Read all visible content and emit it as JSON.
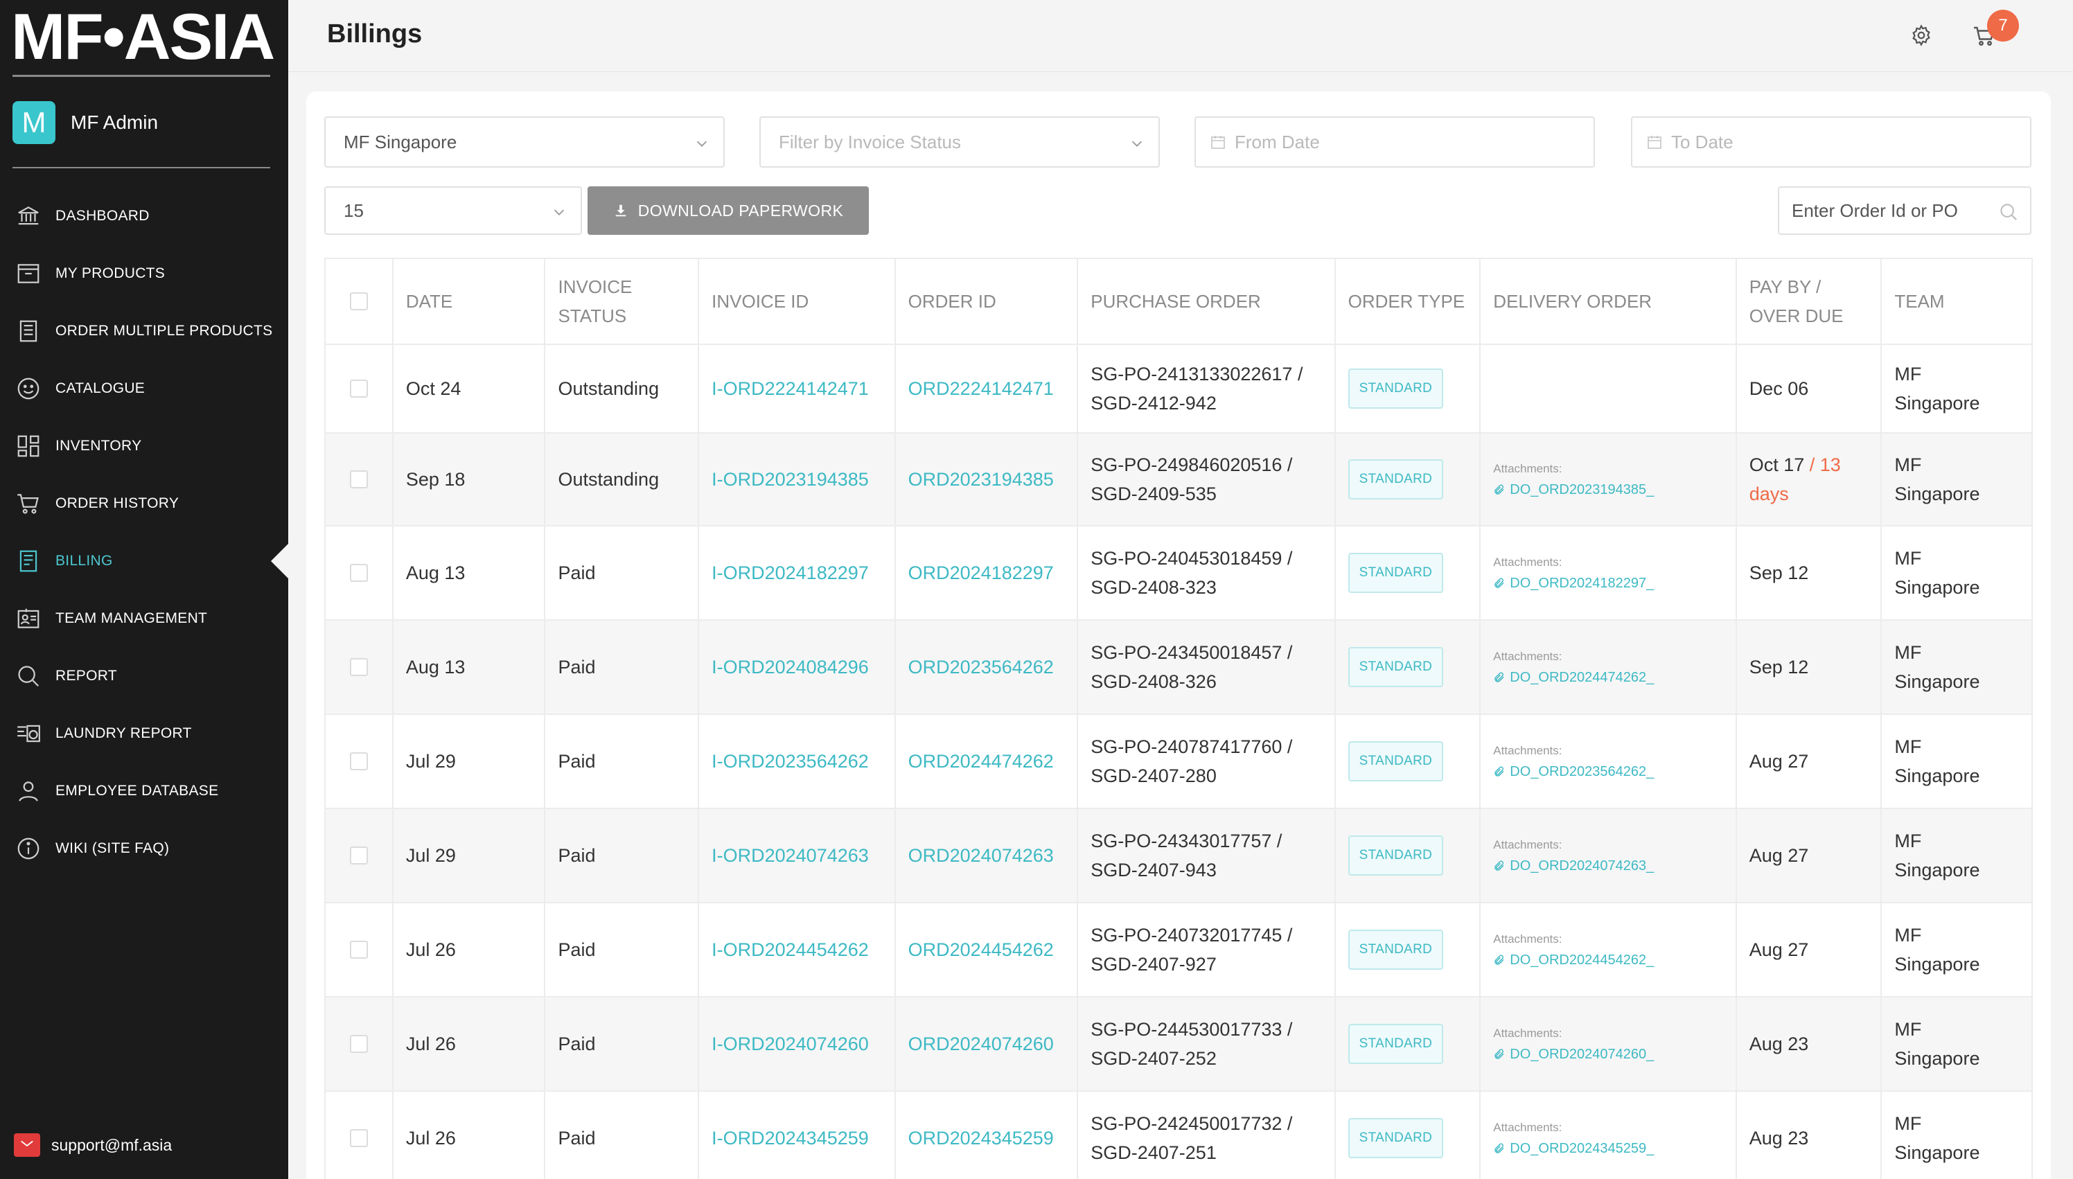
{
  "app": {
    "logo_text": "MF•ASIA",
    "admin_initial": "M",
    "admin_name": "MF Admin",
    "support_email": "support@mf.asia",
    "accent_color": "#3db9c4",
    "badge_color": "#ef6a47"
  },
  "nav": [
    {
      "label": "DASHBOARD",
      "icon": "bank-icon",
      "active": false
    },
    {
      "label": "MY PRODUCTS",
      "icon": "product-box-icon",
      "active": false
    },
    {
      "label": "ORDER MULTIPLE PRODUCTS",
      "icon": "list-document-icon",
      "active": false
    },
    {
      "label": "CATALOGUE",
      "icon": "smiley-icon",
      "active": false
    },
    {
      "label": "INVENTORY",
      "icon": "grid-icon",
      "active": false
    },
    {
      "label": "ORDER HISTORY",
      "icon": "cart-icon",
      "active": false
    },
    {
      "label": "BILLING",
      "icon": "invoice-icon",
      "active": true
    },
    {
      "label": "TEAM MANAGEMENT",
      "icon": "team-icon",
      "active": false
    },
    {
      "label": "REPORT",
      "icon": "search-icon",
      "active": false
    },
    {
      "label": "LAUNDRY REPORT",
      "icon": "laundry-icon",
      "active": false
    },
    {
      "label": "EMPLOYEE DATABASE",
      "icon": "person-icon",
      "active": false
    },
    {
      "label": "WIKI (SITE FAQ)",
      "icon": "info-icon",
      "active": false
    }
  ],
  "header": {
    "title": "Billings",
    "cart_count": "7"
  },
  "filters": {
    "company": "MF Singapore",
    "invoice_status_placeholder": "Filter by Invoice Status",
    "from_date_placeholder": "From Date",
    "to_date_placeholder": "To Date",
    "page_size": "15",
    "download_label": "DOWNLOAD PAPERWORK",
    "search_placeholder": "Enter Order Id or PO"
  },
  "table": {
    "headers": {
      "date": "DATE",
      "invoice_status_1": "INVOICE",
      "invoice_status_2": "STATUS",
      "invoice_id": "INVOICE ID",
      "order_id": "ORDER ID",
      "purchase_order": "PURCHASE ORDER",
      "order_type": "ORDER TYPE",
      "delivery_order": "DELIVERY ORDER",
      "pay_by_1": "PAY BY /",
      "pay_by_2": "OVER DUE",
      "team": "TEAM"
    },
    "attachments_label": "Attachments:",
    "rows": [
      {
        "date": "Oct 24",
        "status": "Outstanding",
        "invoice_id": "I-ORD2224142471",
        "order_id": "ORD2224142471",
        "po_1": "SG-PO-2413133022617 /",
        "po_2": "SGD-2412-942",
        "type": "STANDARD",
        "attachment": "",
        "pay_by": "Dec 06",
        "overdue_1": "",
        "overdue_2": "",
        "team_1": "MF",
        "team_2": "Singapore"
      },
      {
        "date": "Sep 18",
        "status": "Outstanding",
        "invoice_id": "I-ORD2023194385",
        "order_id": "ORD2023194385",
        "po_1": "SG-PO-249846020516 /",
        "po_2": "SGD-2409-535",
        "type": "STANDARD",
        "attachment": "DO_ORD2023194385_",
        "pay_by": "Oct 17",
        "overdue_1": "/ 13",
        "overdue_2": "days",
        "team_1": "MF",
        "team_2": "Singapore"
      },
      {
        "date": "Aug 13",
        "status": "Paid",
        "invoice_id": "I-ORD2024182297",
        "order_id": "ORD2024182297",
        "po_1": "SG-PO-240453018459 /",
        "po_2": "SGD-2408-323",
        "type": "STANDARD",
        "attachment": "DO_ORD2024182297_",
        "pay_by": "Sep 12",
        "overdue_1": "",
        "overdue_2": "",
        "team_1": "MF",
        "team_2": "Singapore"
      },
      {
        "date": "Aug 13",
        "status": "Paid",
        "invoice_id": "I-ORD2024084296",
        "order_id": "ORD2023564262",
        "po_1": "SG-PO-243450018457 /",
        "po_2": "SGD-2408-326",
        "type": "STANDARD",
        "attachment": "DO_ORD2024474262_",
        "pay_by": "Sep 12",
        "overdue_1": "",
        "overdue_2": "",
        "team_1": "MF",
        "team_2": "Singapore"
      },
      {
        "date": "Jul 29",
        "status": "Paid",
        "invoice_id": "I-ORD2023564262",
        "order_id": "ORD2024474262",
        "po_1": "SG-PO-240787417760 /",
        "po_2": "SGD-2407-280",
        "type": "STANDARD",
        "attachment": "DO_ORD2023564262_",
        "pay_by": "Aug 27",
        "overdue_1": "",
        "overdue_2": "",
        "team_1": "MF",
        "team_2": "Singapore"
      },
      {
        "date": "Jul 29",
        "status": "Paid",
        "invoice_id": "I-ORD2024074263",
        "order_id": "ORD2024074263",
        "po_1": "SG-PO-24343017757 /",
        "po_2": "SGD-2407-943",
        "type": "STANDARD",
        "attachment": "DO_ORD2024074263_",
        "pay_by": "Aug 27",
        "overdue_1": "",
        "overdue_2": "",
        "team_1": "MF",
        "team_2": "Singapore"
      },
      {
        "date": "Jul 26",
        "status": "Paid",
        "invoice_id": "I-ORD2024454262",
        "order_id": "ORD2024454262",
        "po_1": "SG-PO-240732017745 /",
        "po_2": "SGD-2407-927",
        "type": "STANDARD",
        "attachment": "DO_ORD2024454262_",
        "pay_by": "Aug 27",
        "overdue_1": "",
        "overdue_2": "",
        "team_1": "MF",
        "team_2": "Singapore"
      },
      {
        "date": "Jul 26",
        "status": "Paid",
        "invoice_id": "I-ORD2024074260",
        "order_id": "ORD2024074260",
        "po_1": "SG-PO-244530017733 /",
        "po_2": "SGD-2407-252",
        "type": "STANDARD",
        "attachment": "DO_ORD2024074260_",
        "pay_by": "Aug 23",
        "overdue_1": "",
        "overdue_2": "",
        "team_1": "MF",
        "team_2": "Singapore"
      },
      {
        "date": "Jul 26",
        "status": "Paid",
        "invoice_id": "I-ORD2024345259",
        "order_id": "ORD2024345259",
        "po_1": "SG-PO-242450017732 /",
        "po_2": "SGD-2407-251",
        "type": "STANDARD",
        "attachment": "DO_ORD2024345259_",
        "pay_by": "Aug 23",
        "overdue_1": "",
        "overdue_2": "",
        "team_1": "MF",
        "team_2": "Singapore"
      }
    ]
  }
}
